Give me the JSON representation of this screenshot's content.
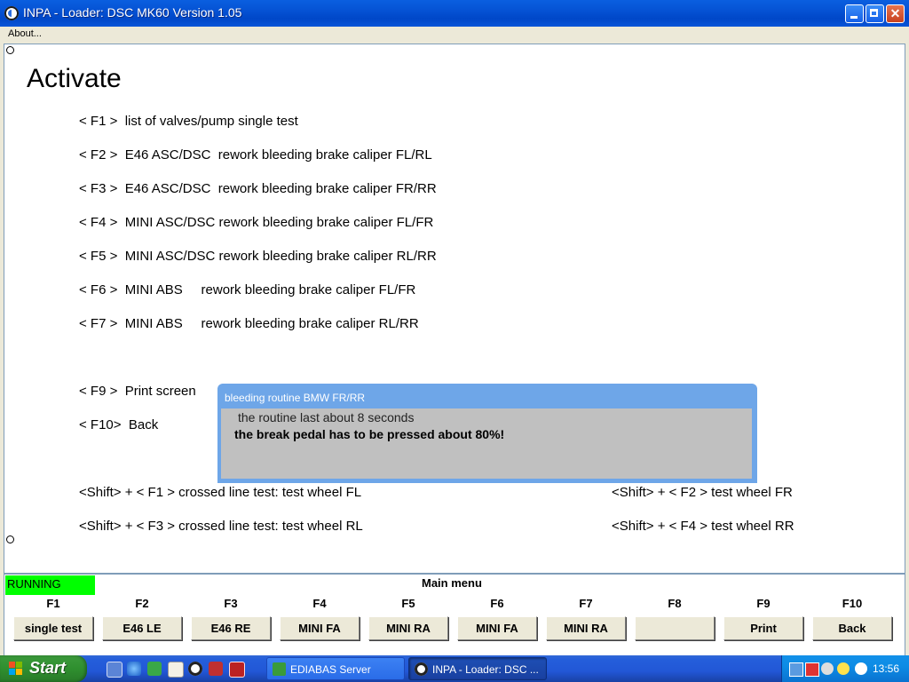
{
  "window": {
    "title": "INPA - Loader:  DSC MK60 Version 1.05"
  },
  "menu": {
    "about_label": "About..."
  },
  "screen": {
    "title": "Activate",
    "options": [
      "< F1 >  list of valves/pump single test",
      "< F2 >  E46 ASC/DSC  rework bleeding brake caliper FL/RL",
      "< F3 >  E46 ASC/DSC  rework bleeding brake caliper FR/RR",
      "< F4 >  MINI ASC/DSC rework bleeding brake caliper FL/FR",
      "< F5 >  MINI ASC/DSC rework bleeding brake caliper RL/RR",
      "< F6 >  MINI ABS     rework bleeding brake caliper FL/FR",
      "< F7 >  MINI ABS     rework bleeding brake caliper RL/RR",
      "< F9 >  Print screen",
      "< F10>  Back"
    ],
    "shift_options_left": [
      "<Shift> + < F1 > crossed line test: test wheel FL",
      "<Shift> + < F3 > crossed line test: test wheel RL"
    ],
    "shift_options_right": [
      "<Shift> + < F2 > test wheel FR",
      "<Shift> + < F4 > test wheel RR"
    ]
  },
  "dialog": {
    "title": "bleeding routine BMW FR/RR",
    "line1": "the routine last about 8 seconds",
    "line2": "the break pedal has to be pressed about 80%!"
  },
  "status": {
    "state": "RUNNING",
    "state_color": "#00ff00",
    "menu_name": "Main menu"
  },
  "fkeys": [
    {
      "key": "F1",
      "label": "single test"
    },
    {
      "key": "F2",
      "label": "E46 LE"
    },
    {
      "key": "F3",
      "label": "E46 RE"
    },
    {
      "key": "F4",
      "label": "MINI FA"
    },
    {
      "key": "F5",
      "label": "MINI RA"
    },
    {
      "key": "F6",
      "label": "MINI FA"
    },
    {
      "key": "F7",
      "label": "MINI RA"
    },
    {
      "key": "F8",
      "label": ""
    },
    {
      "key": "F9",
      "label": "Print"
    },
    {
      "key": "F10",
      "label": "Back"
    }
  ],
  "taskbar": {
    "start_label": "Start",
    "tasks": [
      {
        "label": "EDIABAS Server"
      },
      {
        "label": "INPA - Loader:  DSC ..."
      }
    ],
    "clock": "13:56"
  },
  "icons": {
    "app": "bmw-logo-icon",
    "minimize": "minimize-icon",
    "maximize": "maximize-icon",
    "close": "close-icon"
  }
}
